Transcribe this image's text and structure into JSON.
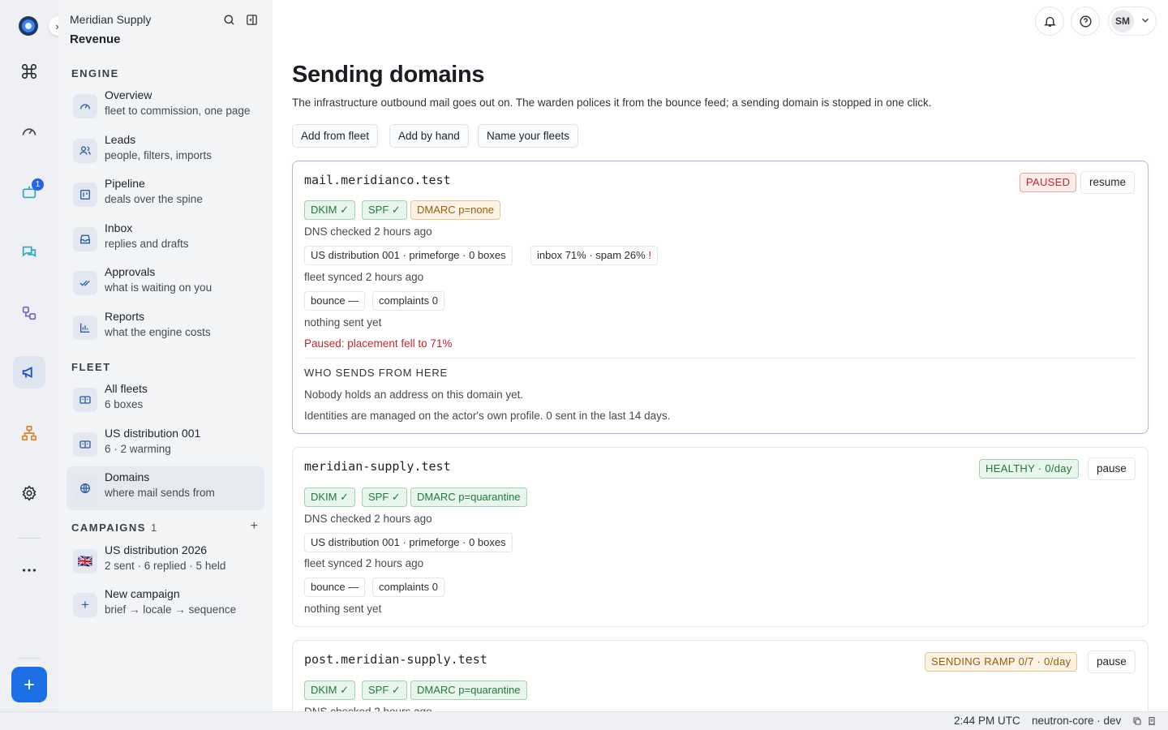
{
  "app": {
    "org_name": "Meridian Supply",
    "workspace": "Revenue",
    "rail_badge": "1"
  },
  "sidebar": {
    "sections": [
      {
        "title": "ENGINE",
        "items": [
          {
            "label": "Overview",
            "sub": "fleet to commission, one page",
            "icon": "gauge-icon"
          },
          {
            "label": "Leads",
            "sub": "people, filters, imports",
            "icon": "users-icon"
          },
          {
            "label": "Pipeline",
            "sub": "deals over the spine",
            "icon": "kanban-icon"
          },
          {
            "label": "Inbox",
            "sub": "replies and drafts",
            "icon": "inbox-icon"
          },
          {
            "label": "Approvals",
            "sub": "what is waiting on you",
            "icon": "double-check-icon"
          },
          {
            "label": "Reports",
            "sub": "what the engine costs",
            "icon": "bar-chart-icon"
          }
        ]
      },
      {
        "title": "FLEET",
        "items": [
          {
            "label": "All fleets",
            "sub": "6 boxes",
            "icon": "fleet-icon"
          },
          {
            "label": "US distribution 001",
            "sub": "6 · 2 warming",
            "icon": "fleet-icon"
          },
          {
            "label": "Domains",
            "sub": "where mail sends from",
            "icon": "globe-icon",
            "active": true
          }
        ]
      },
      {
        "title": "CAMPAIGNS",
        "count": "1",
        "items": [
          {
            "label": "US distribution 2026",
            "sub": "2 sent · 6 replied · 5 held",
            "icon": "uk-flag-icon",
            "flag": "🇬🇧"
          },
          {
            "label": "New campaign",
            "sub": "brief → locale → sequence",
            "icon": "plus-icon",
            "glyph": "+"
          }
        ]
      }
    ]
  },
  "header": {
    "avatar_initials": "SM"
  },
  "page": {
    "title": "Sending domains",
    "description": "The infrastructure outbound mail goes out on. The warden polices it from the bounce feed; a sending domain is stopped in one click.",
    "actions": [
      "Add from fleet",
      "Add by hand",
      "Name your fleets"
    ]
  },
  "domains": [
    {
      "name": "mail.meridianco.test",
      "status": "PAUSED",
      "action": "resume",
      "tags": [
        "DKIM ✓",
        "SPF ✓",
        "DMARC p=none"
      ],
      "dns_checked": "DNS checked 2 hours ago",
      "fleet_chip": "US distribution 001 · primeforge · 0 boxes",
      "placement_chip": "inbox 71% · spam 26%",
      "placement_warn": "!",
      "fleet_synced": "fleet synced 2 hours ago",
      "bounce": "bounce —",
      "complaints": "complaints 0",
      "sent_status": "nothing sent yet",
      "alert": "Paused: placement fell to 71%",
      "who_title": "WHO SENDS FROM HERE",
      "who_line1": "Nobody holds an address on this domain yet.",
      "who_line2": "Identities are managed on the actor's own profile. 0 sent in the last 14 days."
    },
    {
      "name": "meridian-supply.test",
      "status": "HEALTHY · 0/day",
      "action": "pause",
      "tags": [
        "DKIM ✓",
        "SPF ✓",
        "DMARC p=quarantine"
      ],
      "dns_checked": "DNS checked 2 hours ago",
      "fleet_chip": "US distribution 001 · primeforge · 0 boxes",
      "fleet_synced": "fleet synced 2 hours ago",
      "bounce": "bounce —",
      "complaints": "complaints 0",
      "sent_status": "nothing sent yet"
    },
    {
      "name": "post.meridian-supply.test",
      "status": "SENDING RAMP 0/7 · 0/day",
      "action": "pause",
      "tags": [
        "DKIM ✓",
        "SPF ✓",
        "DMARC p=quarantine"
      ],
      "dns_checked": "DNS checked 2 hours ago"
    }
  ],
  "footer": {
    "time": "2:44 PM UTC",
    "env": "neutron-core · dev"
  },
  "colors": {
    "accent": "#1d6fe8",
    "status_paused": "#c0282c",
    "status_healthy": "#1f7a3a",
    "status_ramp": "#9a5b0e"
  }
}
